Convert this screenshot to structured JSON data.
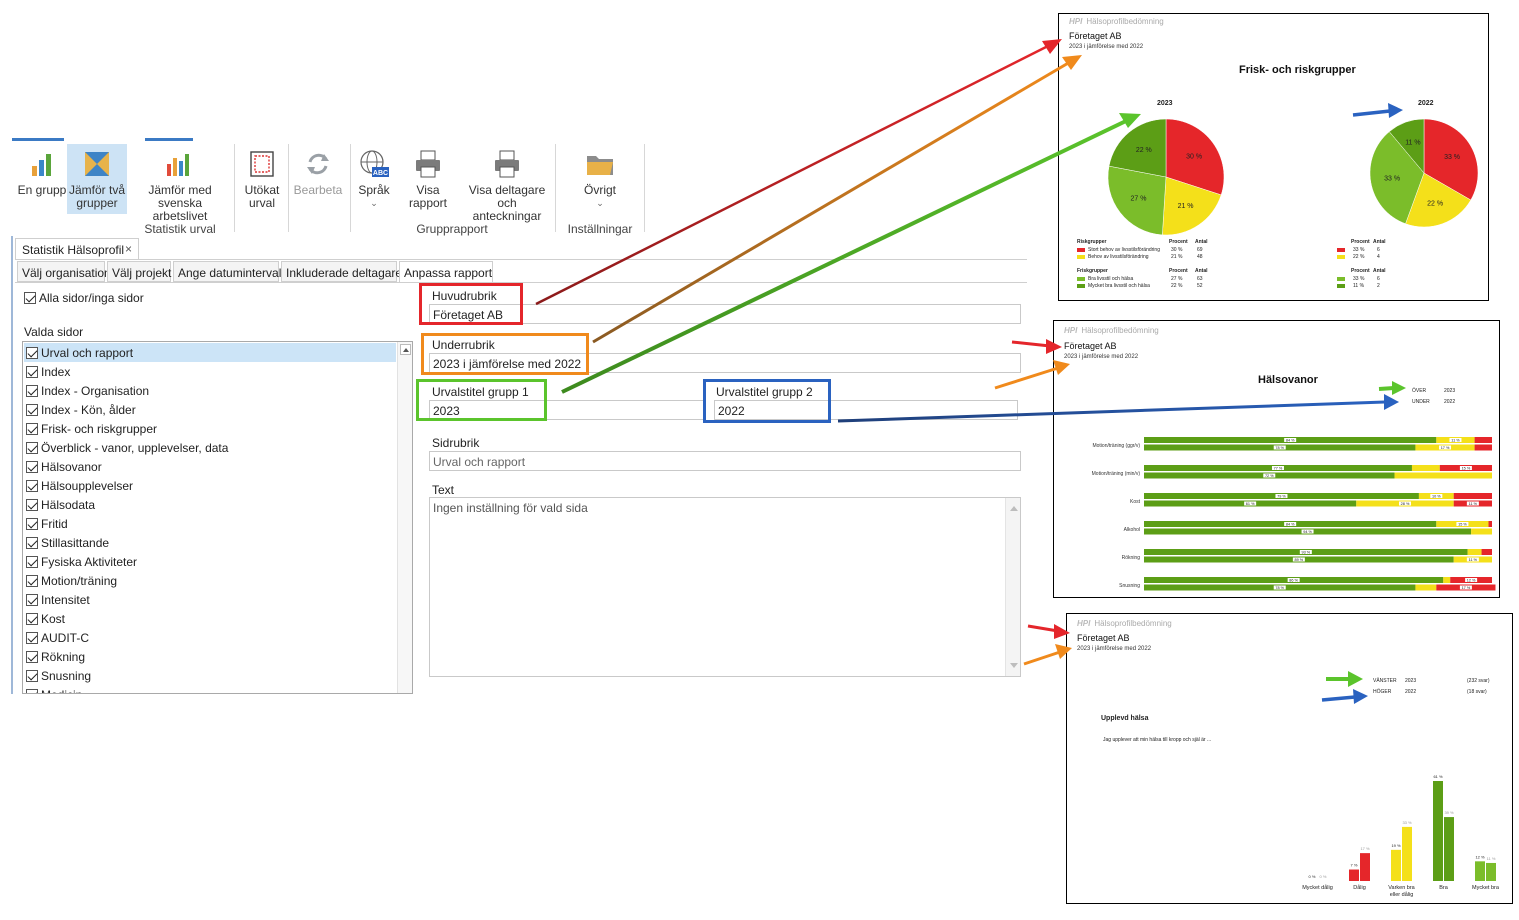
{
  "ribbon": {
    "buttons": [
      {
        "label": "En grupp"
      },
      {
        "label": "Jämför två grupper"
      },
      {
        "label": "Jämför med svenska arbetslivet"
      },
      {
        "label": "Utökat urval"
      },
      {
        "label": "Bearbeta"
      },
      {
        "label": "Språk"
      },
      {
        "label": "Visa rapport"
      },
      {
        "label": "Visa deltagare och anteckningar"
      },
      {
        "label": "Övrigt"
      }
    ],
    "groups": [
      "Statistik urval",
      "Grupprapport",
      "Inställningar"
    ],
    "icon_text": "ABC"
  },
  "document_tab": {
    "label": "Statistik Hälsoprofil",
    "close": "×"
  },
  "subtabs": [
    "Välj organisation",
    "Välj projekt",
    "Ange datumintervall",
    "Inkluderade deltagare",
    "Anpassa rapport"
  ],
  "left_panel": {
    "all_pages_label": "Alla sidor/inga sidor",
    "selected_pages_label": "Valda sidor",
    "pages": [
      "Urval och rapport",
      "Index",
      "Index - Organisation",
      "Index - Kön, ålder",
      "Frisk- och riskgrupper",
      "Överblick - vanor, upplevelser, data",
      "Hälsovanor",
      "Hälsoupplevelser",
      "Hälsodata",
      "Fritid",
      "Stillasittande",
      "Fysiska Aktiviteter",
      "Motion/träning",
      "Intensitet",
      "Kost",
      "AUDIT-C",
      "Rökning",
      "Snusning",
      "Medicin"
    ]
  },
  "form": {
    "huvudrubrik_label": "Huvudrubrik",
    "huvudrubrik_value": "Företaget AB",
    "underrubrik_label": "Underrubrik",
    "underrubrik_value": "2023 i jämförelse med 2022",
    "group1_label": "Urvalstitel grupp 1",
    "group1_value": "2023",
    "group2_label": "Urvalstitel grupp 2",
    "group2_value": "2022",
    "sidrubrik_label": "Sidrubrik",
    "sidrubrik_value": "Urval och rapport",
    "text_label": "Text",
    "text_value": "Ingen inställning för vald sida"
  },
  "colors": {
    "red": "#e4262b",
    "orange": "#f08a1c",
    "green": "#5bc42c",
    "blue": "#2a62c0",
    "chart_green": "#5c9e16",
    "chart_lightgreen": "#7bbd2a",
    "chart_yellow": "#f4e01a",
    "chart_red": "#e5262a"
  },
  "report1": {
    "brand_logo": "HPI",
    "brand_text": "Hälsoprofilbedömning",
    "title": "Företaget AB",
    "subtitle": "2023 i jämförelse med 2022",
    "heading": "Frisk- och riskgrupper",
    "pie_left_label": "2023",
    "pie_right_label": "2022",
    "legend_risk": "Riskgrupper",
    "legend_frisk": "Friskgrupper",
    "col_procent": "Procent",
    "col_antal": "Antal",
    "rows_risk": [
      {
        "label": "Stort behov av livsstilsförändring",
        "p1": "30 %",
        "a1": "69",
        "p2": "33 %",
        "a2": "6"
      },
      {
        "label": "Behov av livsstilsförändring",
        "p1": "21 %",
        "a1": "48",
        "p2": "22 %",
        "a2": "4"
      }
    ],
    "rows_frisk": [
      {
        "label": "Bra livsstil och hälsa",
        "p1": "27 %",
        "a1": "63",
        "p2": "33 %",
        "a2": "6"
      },
      {
        "label": "Mycket bra livsstil och hälsa",
        "p1": "22 %",
        "a1": "52",
        "p2": "11 %",
        "a2": "2"
      }
    ]
  },
  "report2": {
    "brand_logo": "HPI",
    "brand_text": "Hälsoprofilbedömning",
    "title": "Företaget AB",
    "subtitle": "2023 i jämförelse med 2022",
    "heading": "Hälsovanor",
    "legend_over": "ÖVER",
    "legend_under": "UNDER",
    "legend_over_val": "2023",
    "legend_under_val": "2022"
  },
  "report3": {
    "brand_logo": "HPI",
    "brand_text": "Hälsoprofilbedömning",
    "title": "Företaget AB",
    "subtitle": "2023 i jämförelse med 2022",
    "legend_left": "VÄNSTER",
    "legend_right": "HÖGER",
    "legend_left_val": "2023",
    "legend_right_val": "2022",
    "legend_left_n": "(232 svar)",
    "legend_right_n": "(18 svar)",
    "heading": "Upplevd hälsa",
    "question": "Jag upplever att min hälsa till kropp och själ är ..."
  },
  "chart_data": [
    {
      "type": "pie",
      "title": "2023",
      "categories": [
        "Stort behov av livsstilsförändring",
        "Behov av livsstilsförändring",
        "Bra livsstil och hälsa",
        "Mycket bra livsstil och hälsa"
      ],
      "values": [
        30,
        21,
        27,
        22
      ],
      "labels": [
        "30 %",
        "21 %",
        "27 %",
        "22 %"
      ],
      "colors": [
        "#e5262a",
        "#f4e01a",
        "#7bbd2a",
        "#5c9e16"
      ]
    },
    {
      "type": "pie",
      "title": "2022",
      "categories": [
        "Stort behov av livsstilsförändring",
        "Behov av livsstilsförändring",
        "Bra livsstil och hälsa",
        "Mycket bra livsstil och hälsa"
      ],
      "values": [
        33,
        22,
        33,
        11
      ],
      "labels": [
        "33 %",
        "22 %",
        "33 %",
        "11 %"
      ],
      "colors": [
        "#e5262a",
        "#f4e01a",
        "#7bbd2a",
        "#5c9e16"
      ]
    },
    {
      "type": "bar",
      "orientation": "horizontal-stacked",
      "title": "Hälsovanor",
      "categories": [
        "Motion/träning (ggr/v)",
        "Motion/träning (min/v)",
        "Kost",
        "Alkohol",
        "Rökning",
        "Snusning"
      ],
      "series": [
        {
          "name": "2023",
          "values": [
            [
              84,
              11,
              5
            ],
            [
              77,
              8,
              15
            ],
            [
              79,
              10,
              11
            ],
            [
              84,
              15,
              1
            ],
            [
              93,
              4,
              3
            ],
            [
              86,
              2,
              12
            ]
          ],
          "labels": [
            [
              "84 %",
              "11 %",
              ""
            ],
            [
              "77 %",
              "",
              "15 %"
            ],
            [
              "79 %",
              "10 %",
              ""
            ],
            [
              "84 %",
              "15 %",
              ""
            ],
            [
              "93 %",
              "",
              ""
            ],
            [
              "86 %",
              "",
              "12 %"
            ]
          ]
        },
        {
          "name": "2022",
          "values": [
            [
              78,
              17,
              5
            ],
            [
              72,
              28,
              0
            ],
            [
              61,
              28,
              11
            ],
            [
              94,
              6,
              0
            ],
            [
              89,
              11,
              0
            ],
            [
              78,
              6,
              17
            ]
          ],
          "labels": [
            [
              "78 %",
              "17 %",
              ""
            ],
            [
              "72 %",
              "",
              ""
            ],
            [
              "61 %",
              "28 %",
              "11 %"
            ],
            [
              "94 %",
              "",
              ""
            ],
            [
              "89 %",
              "11 %",
              ""
            ],
            [
              "78 %",
              "",
              "17 %"
            ]
          ]
        }
      ],
      "segment_colors": [
        "#5c9e16",
        "#f4e01a",
        "#e5262a"
      ]
    },
    {
      "type": "bar",
      "title": "Upplevd hälsa",
      "categories": [
        "Mycket dålig",
        "Dålig",
        "Varken bra eller dålig",
        "Bra",
        "Mycket bra"
      ],
      "series": [
        {
          "name": "2023",
          "values": [
            0,
            7,
            19,
            61,
            12
          ],
          "labels": [
            "0 %",
            "7 %",
            "19 %",
            "61 %",
            "12 %"
          ]
        },
        {
          "name": "2022",
          "values": [
            0,
            17,
            33,
            39,
            11
          ],
          "labels": [
            "0 %",
            "17 %",
            "33 %",
            "39 %",
            "11 %"
          ]
        }
      ],
      "category_colors": [
        "#e5262a",
        "#e5262a",
        "#f4e01a",
        "#5c9e16",
        "#7bbd2a"
      ]
    }
  ]
}
